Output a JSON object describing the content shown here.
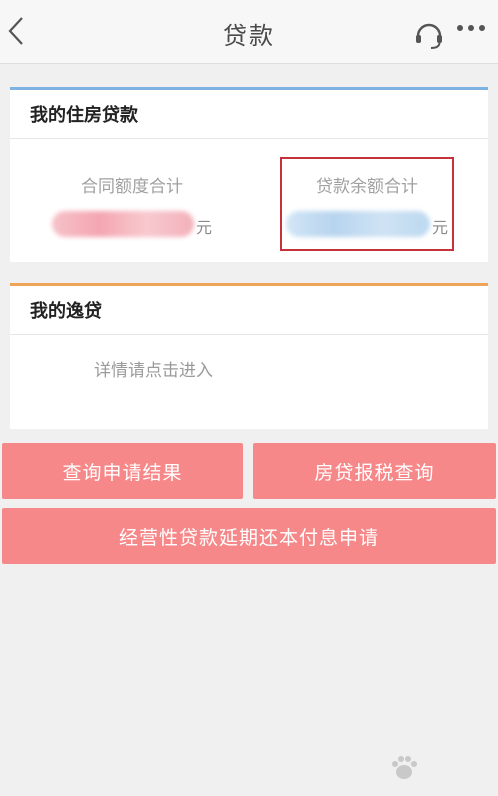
{
  "header": {
    "title": "贷款"
  },
  "housing_loan": {
    "title": "我的住房贷款",
    "contract_amount_label": "合同额度合计",
    "contract_amount_unit": "元",
    "balance_label": "贷款余额合计",
    "balance_unit": "元"
  },
  "yidai": {
    "title": "我的逸贷",
    "detail_text": "详情请点击进入"
  },
  "actions": {
    "query_result_label": "查询申请结果",
    "tax_query_label": "房贷报税查询",
    "extension_label": "经营性贷款延期还本付息申请"
  },
  "colors": {
    "accent_blue": "#7cb3e3",
    "accent_orange": "#f0a45a",
    "button": "#f68889",
    "highlight": "#c4333b"
  },
  "icons": [
    "back-chevron-icon",
    "headset-icon",
    "more-dots-icon",
    "baidu-paw-icon"
  ]
}
